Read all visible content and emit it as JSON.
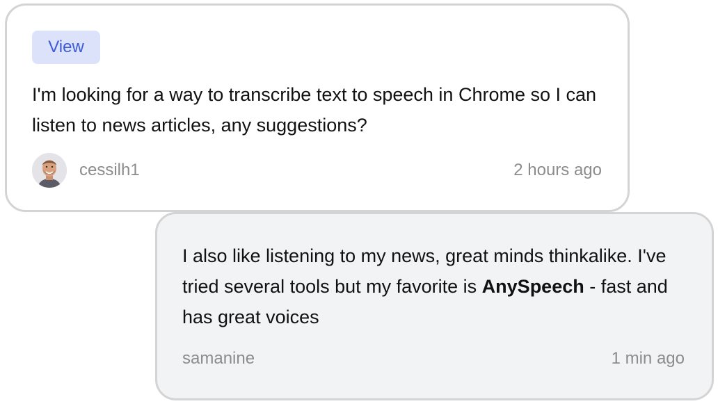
{
  "question": {
    "badge_label": "View",
    "text": "I'm looking for a way to transcribe text to speech in Chrome so I can listen to news articles, any suggestions?",
    "author": "cessilh1",
    "avatar_icon": "user-avatar-photo",
    "time": "2 hours ago"
  },
  "reply": {
    "text_before": "I also like listening to my news, great minds thinkalike. I've tried several tools but my favorite is ",
    "highlight": "AnySpeech",
    "text_after": " - fast and has great voices",
    "author": "samanine",
    "time": "1 min ago"
  },
  "colors": {
    "badge_bg": "#dde2fb",
    "badge_text": "#3d5bd8",
    "reply_bg": "#f2f3f5",
    "card_border": "#d4d4d4",
    "meta_text": "#8c8c8c"
  }
}
